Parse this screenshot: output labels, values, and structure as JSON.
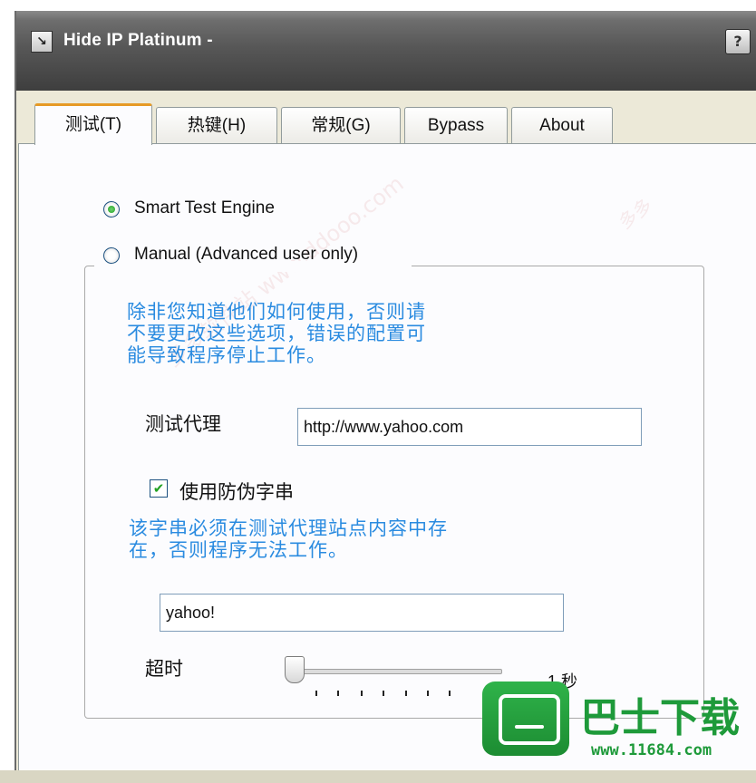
{
  "window": {
    "title": "Hide IP Platinum -",
    "icon_glyph": "↘",
    "help_glyph": "?"
  },
  "tabs": [
    {
      "label": "测试(T)",
      "active": true
    },
    {
      "label": "热键(H)",
      "active": false
    },
    {
      "label": "常规(G)",
      "active": false
    },
    {
      "label": "Bypass",
      "active": false
    },
    {
      "label": "About",
      "active": false
    }
  ],
  "engine": {
    "smart_label": "Smart Test Engine",
    "manual_label": "Manual (Advanced user only)",
    "selected": "smart"
  },
  "manual": {
    "warning": "除非您知道他们如何使用，否则请\n不要更改这些选项，错误的配置可\n能导致程序停止工作。",
    "proxy_label": "测试代理",
    "proxy_url": "http://www.yahoo.com",
    "antifake_label": "使用防伪字串",
    "antifake_checked": true,
    "antifake_hint": "该字串必须在测试代理站点内容中存\n在，否则程序无法工作。",
    "antifake_value": "yahoo!",
    "timeout_label": "超时",
    "timeout_value": "1 秒",
    "timeout_level": 0
  },
  "watermark": {
    "title": "巴士下载",
    "url": "www.11684.com",
    "faint_text": "多多软件站 www.ddooo.com"
  },
  "colors": {
    "hint_text": "#2a8be0",
    "tab_highlight": "#e69a26",
    "check_green": "#21a121",
    "watermark_green": "#1e9a3a"
  }
}
